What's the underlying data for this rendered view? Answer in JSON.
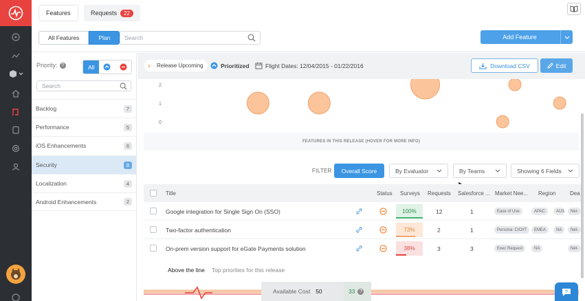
{
  "colors": {
    "brand_red": "#e8433f",
    "accent_blue": "#3b95e2",
    "bubble_fill": "#fbc49a",
    "bubble_stroke": "#f0a36c",
    "green": "#41b06e",
    "orange": "#f0a36c",
    "red": "#e8433f"
  },
  "header": {
    "tabs": [
      {
        "label": "Features"
      },
      {
        "label": "Requests",
        "badge": "22"
      }
    ]
  },
  "toolbar": {
    "view_buttons": [
      "All Features",
      "Plan"
    ],
    "search_placeholder": "Search",
    "add_label": "Add Feature"
  },
  "sidebar": {
    "priority_label": "Priority:",
    "priority_all": "All",
    "search_placeholder": "Search",
    "items": [
      {
        "label": "Backlog",
        "count": "7"
      },
      {
        "label": "Performance",
        "count": "5"
      },
      {
        "label": "iOS Enhancements",
        "count": "6"
      },
      {
        "label": "Security",
        "count": "8"
      },
      {
        "label": "Localization",
        "count": "4"
      },
      {
        "label": "Android Enhancements",
        "count": "2"
      }
    ]
  },
  "release": {
    "status": "Release Upcoming",
    "prioritized": "Prioritized",
    "flight_dates": "Flight Dates: 12/04/2015 - 01/22/2016",
    "download_label": "Download CSV",
    "edit_label": "Edit"
  },
  "chart_data": {
    "type": "scatter",
    "y_ticks": [
      "2",
      "1",
      "0"
    ],
    "points": [
      {
        "x": 0.23,
        "y": 1,
        "size": "medium"
      },
      {
        "x": 0.38,
        "y": 1,
        "size": "medium"
      },
      {
        "x": 0.64,
        "y": 2,
        "size": "large"
      },
      {
        "x": 0.83,
        "y": 0,
        "size": "small"
      },
      {
        "x": 0.86,
        "y": 2,
        "size": "small"
      },
      {
        "x": 0.97,
        "y": 1,
        "size": "small"
      }
    ],
    "footer": "FEATURES IN THIS RELEASE (HOVER FOR MORE INFO)"
  },
  "filters": {
    "label": "FILTER",
    "overall": "Overall Score",
    "by_evaluator": "By Evaluator",
    "by_teams": "By Teams",
    "fields": "Showing 6 Fields"
  },
  "table": {
    "columns": [
      "Title",
      "Status",
      "Surveys",
      "Requests",
      "Salesforce ...",
      "Market Nee...",
      "Region",
      "Dea"
    ],
    "rows": [
      {
        "title": "Google integration for Single Sign On (SSO)",
        "survey": "100%",
        "survey_color": "green",
        "requests": "12",
        "salesforce": "1",
        "market": "Ease of Use",
        "region": [
          "APAC",
          "AUS"
        ],
        "deal": "Net-"
      },
      {
        "title": "Two-factor authentication",
        "survey": "73%",
        "survey_color": "orange",
        "requests": "2",
        "salesforce": "1",
        "market": "Persona: CIO/IT",
        "region": [
          "EMEA",
          "NA"
        ],
        "deal": "Net-"
      },
      {
        "title": "On-prem version support for eGate Payments solution",
        "survey": "38%",
        "survey_color": "red",
        "requests": "3",
        "salesforce": "3",
        "market": "Exec Request",
        "region": [
          "NA"
        ],
        "deal": "Net-"
      }
    ]
  },
  "above_line": {
    "label": "Above the line",
    "sub": "Top priorities for this release"
  },
  "cost": {
    "label": "Available Cost",
    "value": "50",
    "alt": "33"
  }
}
